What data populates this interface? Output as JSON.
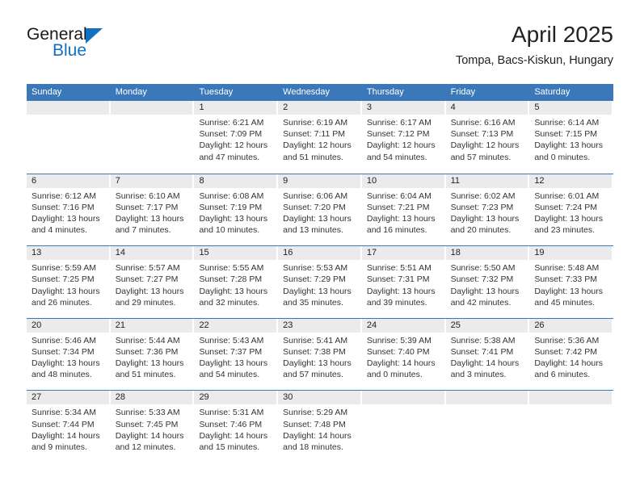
{
  "brand": {
    "name_top": "General",
    "name_bottom": "Blue",
    "accent_color": "#1170c0"
  },
  "header": {
    "title": "April 2025",
    "subtitle": "Tompa, Bacs-Kiskun, Hungary"
  },
  "calendar": {
    "header_color": "#3b78b9",
    "daynum_band_color": "#ebebeb",
    "weekdays": [
      "Sunday",
      "Monday",
      "Tuesday",
      "Wednesday",
      "Thursday",
      "Friday",
      "Saturday"
    ],
    "weeks": [
      [
        {
          "day": "",
          "empty": true
        },
        {
          "day": "",
          "empty": true
        },
        {
          "day": "1",
          "sunrise": "Sunrise: 6:21 AM",
          "sunset": "Sunset: 7:09 PM",
          "daylight": "Daylight: 12 hours and 47 minutes."
        },
        {
          "day": "2",
          "sunrise": "Sunrise: 6:19 AM",
          "sunset": "Sunset: 7:11 PM",
          "daylight": "Daylight: 12 hours and 51 minutes."
        },
        {
          "day": "3",
          "sunrise": "Sunrise: 6:17 AM",
          "sunset": "Sunset: 7:12 PM",
          "daylight": "Daylight: 12 hours and 54 minutes."
        },
        {
          "day": "4",
          "sunrise": "Sunrise: 6:16 AM",
          "sunset": "Sunset: 7:13 PM",
          "daylight": "Daylight: 12 hours and 57 minutes."
        },
        {
          "day": "5",
          "sunrise": "Sunrise: 6:14 AM",
          "sunset": "Sunset: 7:15 PM",
          "daylight": "Daylight: 13 hours and 0 minutes."
        }
      ],
      [
        {
          "day": "6",
          "sunrise": "Sunrise: 6:12 AM",
          "sunset": "Sunset: 7:16 PM",
          "daylight": "Daylight: 13 hours and 4 minutes."
        },
        {
          "day": "7",
          "sunrise": "Sunrise: 6:10 AM",
          "sunset": "Sunset: 7:17 PM",
          "daylight": "Daylight: 13 hours and 7 minutes."
        },
        {
          "day": "8",
          "sunrise": "Sunrise: 6:08 AM",
          "sunset": "Sunset: 7:19 PM",
          "daylight": "Daylight: 13 hours and 10 minutes."
        },
        {
          "day": "9",
          "sunrise": "Sunrise: 6:06 AM",
          "sunset": "Sunset: 7:20 PM",
          "daylight": "Daylight: 13 hours and 13 minutes."
        },
        {
          "day": "10",
          "sunrise": "Sunrise: 6:04 AM",
          "sunset": "Sunset: 7:21 PM",
          "daylight": "Daylight: 13 hours and 16 minutes."
        },
        {
          "day": "11",
          "sunrise": "Sunrise: 6:02 AM",
          "sunset": "Sunset: 7:23 PM",
          "daylight": "Daylight: 13 hours and 20 minutes."
        },
        {
          "day": "12",
          "sunrise": "Sunrise: 6:01 AM",
          "sunset": "Sunset: 7:24 PM",
          "daylight": "Daylight: 13 hours and 23 minutes."
        }
      ],
      [
        {
          "day": "13",
          "sunrise": "Sunrise: 5:59 AM",
          "sunset": "Sunset: 7:25 PM",
          "daylight": "Daylight: 13 hours and 26 minutes."
        },
        {
          "day": "14",
          "sunrise": "Sunrise: 5:57 AM",
          "sunset": "Sunset: 7:27 PM",
          "daylight": "Daylight: 13 hours and 29 minutes."
        },
        {
          "day": "15",
          "sunrise": "Sunrise: 5:55 AM",
          "sunset": "Sunset: 7:28 PM",
          "daylight": "Daylight: 13 hours and 32 minutes."
        },
        {
          "day": "16",
          "sunrise": "Sunrise: 5:53 AM",
          "sunset": "Sunset: 7:29 PM",
          "daylight": "Daylight: 13 hours and 35 minutes."
        },
        {
          "day": "17",
          "sunrise": "Sunrise: 5:51 AM",
          "sunset": "Sunset: 7:31 PM",
          "daylight": "Daylight: 13 hours and 39 minutes."
        },
        {
          "day": "18",
          "sunrise": "Sunrise: 5:50 AM",
          "sunset": "Sunset: 7:32 PM",
          "daylight": "Daylight: 13 hours and 42 minutes."
        },
        {
          "day": "19",
          "sunrise": "Sunrise: 5:48 AM",
          "sunset": "Sunset: 7:33 PM",
          "daylight": "Daylight: 13 hours and 45 minutes."
        }
      ],
      [
        {
          "day": "20",
          "sunrise": "Sunrise: 5:46 AM",
          "sunset": "Sunset: 7:34 PM",
          "daylight": "Daylight: 13 hours and 48 minutes."
        },
        {
          "day": "21",
          "sunrise": "Sunrise: 5:44 AM",
          "sunset": "Sunset: 7:36 PM",
          "daylight": "Daylight: 13 hours and 51 minutes."
        },
        {
          "day": "22",
          "sunrise": "Sunrise: 5:43 AM",
          "sunset": "Sunset: 7:37 PM",
          "daylight": "Daylight: 13 hours and 54 minutes."
        },
        {
          "day": "23",
          "sunrise": "Sunrise: 5:41 AM",
          "sunset": "Sunset: 7:38 PM",
          "daylight": "Daylight: 13 hours and 57 minutes."
        },
        {
          "day": "24",
          "sunrise": "Sunrise: 5:39 AM",
          "sunset": "Sunset: 7:40 PM",
          "daylight": "Daylight: 14 hours and 0 minutes."
        },
        {
          "day": "25",
          "sunrise": "Sunrise: 5:38 AM",
          "sunset": "Sunset: 7:41 PM",
          "daylight": "Daylight: 14 hours and 3 minutes."
        },
        {
          "day": "26",
          "sunrise": "Sunrise: 5:36 AM",
          "sunset": "Sunset: 7:42 PM",
          "daylight": "Daylight: 14 hours and 6 minutes."
        }
      ],
      [
        {
          "day": "27",
          "sunrise": "Sunrise: 5:34 AM",
          "sunset": "Sunset: 7:44 PM",
          "daylight": "Daylight: 14 hours and 9 minutes."
        },
        {
          "day": "28",
          "sunrise": "Sunrise: 5:33 AM",
          "sunset": "Sunset: 7:45 PM",
          "daylight": "Daylight: 14 hours and 12 minutes."
        },
        {
          "day": "29",
          "sunrise": "Sunrise: 5:31 AM",
          "sunset": "Sunset: 7:46 PM",
          "daylight": "Daylight: 14 hours and 15 minutes."
        },
        {
          "day": "30",
          "sunrise": "Sunrise: 5:29 AM",
          "sunset": "Sunset: 7:48 PM",
          "daylight": "Daylight: 14 hours and 18 minutes."
        },
        {
          "day": "",
          "empty": true
        },
        {
          "day": "",
          "empty": true
        },
        {
          "day": "",
          "empty": true
        }
      ]
    ]
  }
}
